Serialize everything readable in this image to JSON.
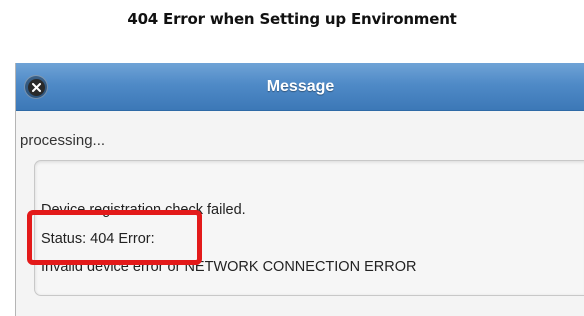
{
  "doc": {
    "heading": "404 Error when Setting up Environment"
  },
  "dialog": {
    "title": "Message",
    "close_icon": "close-icon",
    "header_color": "#4f8ac7",
    "status_text": "processing...",
    "message_lines": [
      "Device registration check failed.",
      "Status: 404 Error:",
      "Invalid device error or NETWORK CONNECTION ERROR"
    ]
  },
  "annotation": {
    "highlight_color": "#e31a1a"
  }
}
